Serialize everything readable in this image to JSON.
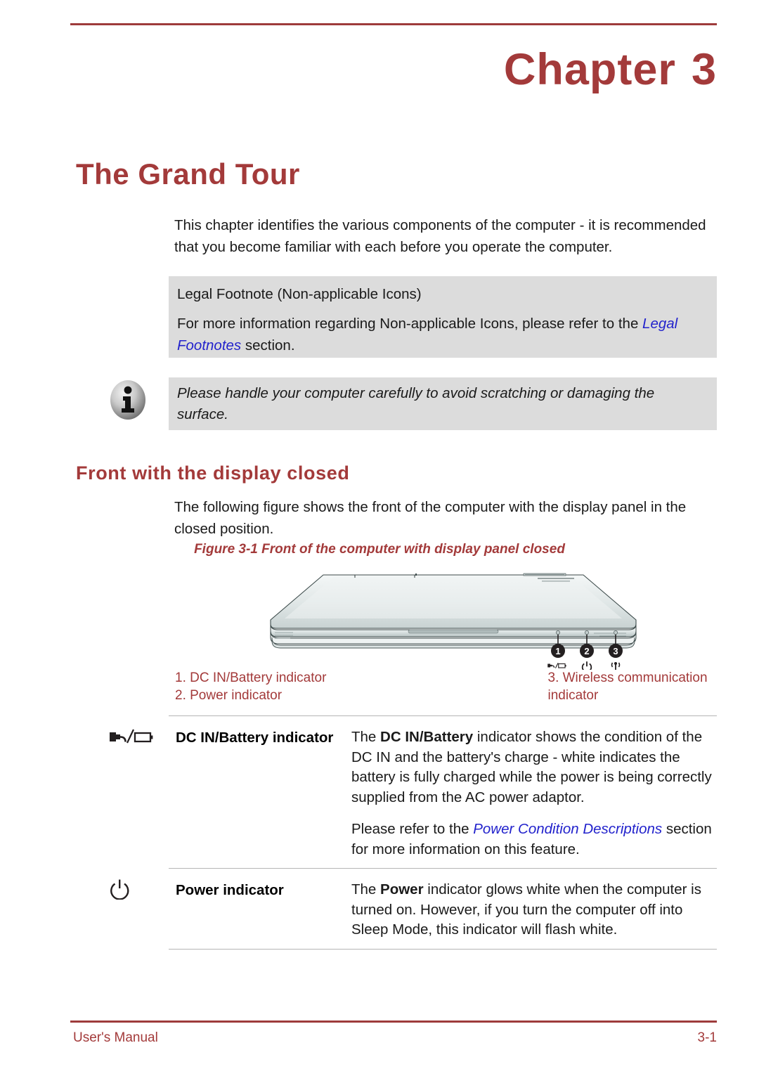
{
  "header": {
    "chapter_label": "Chapter",
    "chapter_number": "3"
  },
  "page_title": "The Grand Tour",
  "intro": {
    "paragraph": "This chapter identifies the various components of the computer - it is recommended that you become familiar with each before you operate the computer."
  },
  "legal_box": {
    "title": "Legal Footnote (Non-applicable Icons)",
    "text_before_link": "For more information regarding Non-applicable Icons, please refer to the ",
    "link_text": "Legal Footnotes",
    "text_after_link": " section."
  },
  "info_box": {
    "icon": "info-circle-icon",
    "text": "Please handle your computer carefully to avoid scratching or damaging the surface."
  },
  "section": {
    "heading": "Front with the display closed",
    "intro": "The following figure shows the front of the computer with the display panel in the closed position."
  },
  "figure": {
    "caption": "Figure 3-1 Front of the computer with display panel closed",
    "alt_name": "laptop-front-closed-illustration",
    "callouts": [
      "1",
      "2",
      "3"
    ],
    "callout_icons": [
      "dc-in-battery-icon",
      "power-icon",
      "wireless-icon"
    ]
  },
  "legend": {
    "left": [
      "1. DC IN/Battery indicator",
      "2. Power indicator"
    ],
    "right": [
      "3. Wireless communication indicator"
    ]
  },
  "indicator_table": {
    "rows": [
      {
        "icon": "dc-in-battery-icon",
        "name": "DC IN/Battery indicator",
        "desc_1_parts": {
          "a": "The ",
          "bold": "DC IN/Battery",
          "b": " indicator shows the condition of the DC IN and the battery's charge - white indicates the battery is fully charged while the power is being correctly supplied from the AC power adaptor."
        },
        "desc_2_parts": {
          "a": "Please refer to the ",
          "link": "Power Condition Descriptions",
          "b": " section for more information on this feature."
        }
      },
      {
        "icon": "power-icon",
        "name": "Power indicator",
        "desc_1_parts": {
          "a": "The ",
          "bold": "Power",
          "b": " indicator glows white when the computer is turned on. However, if you turn the computer off into Sleep Mode, this indicator will flash white."
        }
      }
    ]
  },
  "footer": {
    "left": "User's Manual",
    "right": "3-1"
  },
  "colors": {
    "accent_red": "#a33a3a",
    "gray_box": "#dcdcdc",
    "link_blue": "#2222cc",
    "rule": "#9e3b3b"
  }
}
